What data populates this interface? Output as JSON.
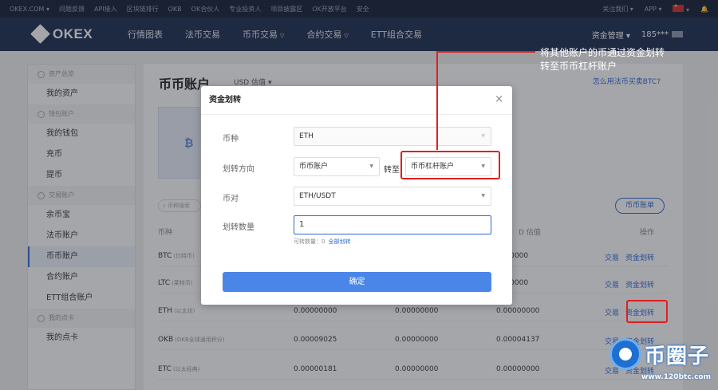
{
  "topbar": {
    "items": [
      "OKEX.COM ▾",
      "问题反馈",
      "API接入",
      "区块链排行",
      "OKB",
      "OK合伙人",
      "专业投资人",
      "项目披露区",
      "OK开放平台",
      "安全"
    ],
    "follow": "关注我们 ▾",
    "app": "APP ▾",
    "lang": "▾"
  },
  "navbar": {
    "logo": "OKEX",
    "items": [
      "行情图表",
      "法币交易",
      "币币交易",
      "合约交易",
      "ETT组合交易"
    ],
    "has_caret": [
      false,
      false,
      true,
      true,
      false
    ],
    "asset_mgmt": "资金管理",
    "user": "185***"
  },
  "sidebar": {
    "groups": [
      {
        "title": "资产总览",
        "items": [
          "我的资产"
        ]
      },
      {
        "title": "钱包账户",
        "items": [
          "我的钱包",
          "充币",
          "提币"
        ]
      },
      {
        "title": "交易账户",
        "items": [
          "余币宝",
          "法币账户",
          "币币账户",
          "合约账户",
          "ETT组合账户"
        ]
      },
      {
        "title": "我的点卡",
        "items": [
          "我的点卡"
        ]
      }
    ],
    "active": "币币账户"
  },
  "main": {
    "title": "币币账户",
    "valuation": "USD 估值 ▾",
    "help_link": "怎么用法币买卖BTC?",
    "balance_symbol": "₿",
    "search_placeholder": "币种搜索",
    "account_button": "币币账单",
    "headers": {
      "coin": "币种",
      "value": "D 估值",
      "ops": "操作"
    },
    "rows": [
      {
        "coin": "BTC",
        "name": "(比特币)",
        "a": "",
        "b": "",
        "c": "0000000"
      },
      {
        "coin": "LTC",
        "name": "(莱特币)",
        "a": "",
        "b": "",
        "c": "0000000"
      },
      {
        "coin": "ETH",
        "name": "(以太坊)",
        "a": "0.00000000",
        "b": "0.00000000",
        "c": "0.00000000"
      },
      {
        "coin": "OKB",
        "name": "(OKB全球通用积分)",
        "a": "0.00009025",
        "b": "0.00000000",
        "c": "0.00004137"
      },
      {
        "coin": "ETC",
        "name": "(以太经典)",
        "a": "0.00000181",
        "b": "0.00000000",
        "c": "0.00000000"
      }
    ],
    "op_trade": "交易",
    "op_transfer": "资金划转"
  },
  "modal": {
    "title": "资金划转",
    "close": "×",
    "currency_label": "币种",
    "currency_value": "ETH",
    "direction_label": "划转方向",
    "from_value": "币币账户",
    "to_label": "转至",
    "to_value": "币币杠杆账户",
    "pair_label": "币对",
    "pair_value": "ETH/USDT",
    "qty_label": "划转数量",
    "qty_value": "1",
    "available_text": "可转数量：0",
    "transfer_all": "全部划转",
    "confirm": "确定"
  },
  "annotation": {
    "line1": "将其他账户的币通过资金划转",
    "line2": "转至币币杠杆账户",
    "color": "#e02020"
  },
  "watermark": {
    "text": "币圈子",
    "url": "www.120btc.com"
  }
}
